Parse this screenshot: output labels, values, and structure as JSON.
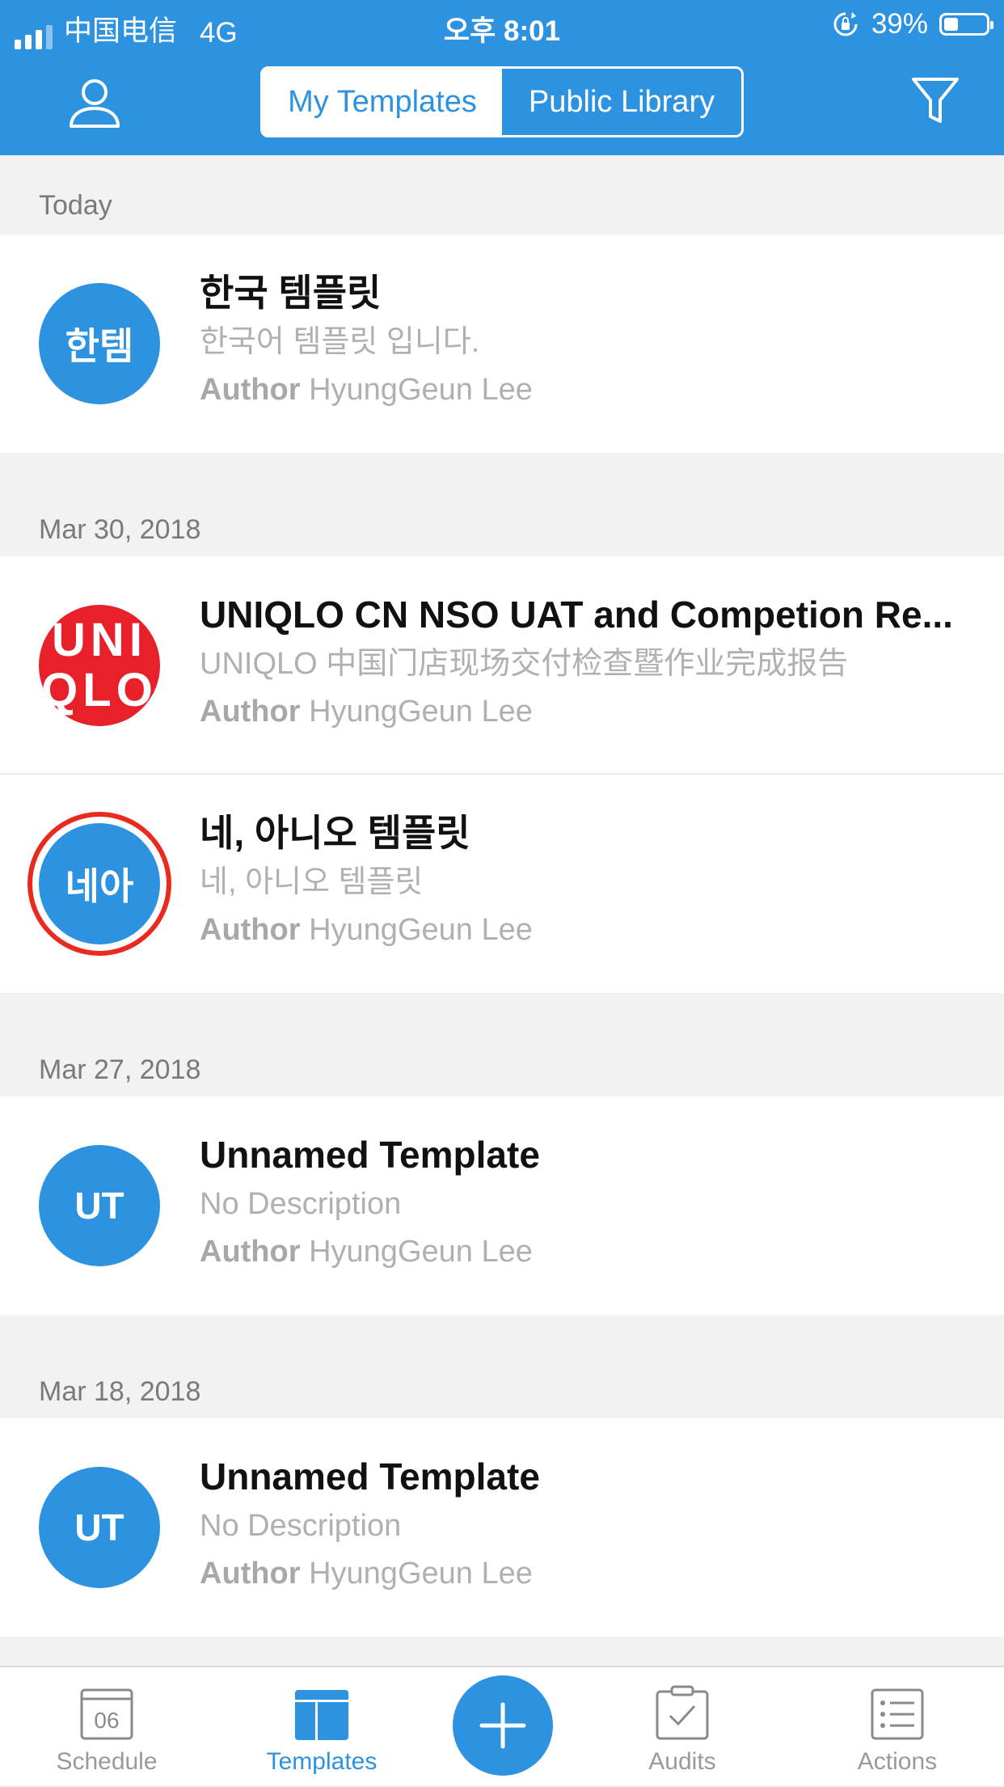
{
  "status_bar": {
    "carrier": "中国电信",
    "network": "4G",
    "time": "오후 8:01",
    "battery": "39%"
  },
  "header": {
    "tabs": [
      {
        "label": "My Templates",
        "active": true
      },
      {
        "label": "Public Library",
        "active": false
      }
    ],
    "accent_color": "#2d93e0"
  },
  "sections": [
    {
      "date": "Today",
      "items": [
        {
          "avatar_text": "한템",
          "title": "한국 템플릿",
          "description": "한국어 템플릿 입니다.",
          "author_label": "Author",
          "author": "HyungGeun Lee"
        }
      ]
    },
    {
      "date": "Mar 30, 2018",
      "items": [
        {
          "avatar_text": "UNIQLO",
          "avatar_line1": "UNI",
          "avatar_line2": "QLO",
          "title": "UNIQLO CN NSO UAT and Competion Re...",
          "description": "UNIQLO 中国门店现场交付检查暨作业完成报告",
          "author_label": "Author",
          "author": "HyungGeun Lee"
        },
        {
          "avatar_text": "네아",
          "title": "네, 아니오 템플릿",
          "description": "네, 아니오 템플릿",
          "author_label": "Author",
          "author": "HyungGeun Lee"
        }
      ]
    },
    {
      "date": "Mar 27, 2018",
      "items": [
        {
          "avatar_text": "UT",
          "title": "Unnamed Template",
          "description": "No Description",
          "author_label": "Author",
          "author": "HyungGeun Lee"
        }
      ]
    },
    {
      "date": "Mar 18, 2018",
      "items": [
        {
          "avatar_text": "UT",
          "title": "Unnamed Template",
          "description": "No Description",
          "author_label": "Author",
          "author": "HyungGeun Lee"
        }
      ]
    }
  ],
  "tabbar": {
    "schedule": {
      "label": "Schedule",
      "icon": "calendar-icon",
      "day": "06"
    },
    "templates": {
      "label": "Templates",
      "icon": "templates-icon",
      "active": true
    },
    "add": {
      "icon": "plus-icon"
    },
    "audits": {
      "label": "Audits",
      "icon": "clipboard-check-icon"
    },
    "actions": {
      "label": "Actions",
      "icon": "list-icon"
    }
  }
}
